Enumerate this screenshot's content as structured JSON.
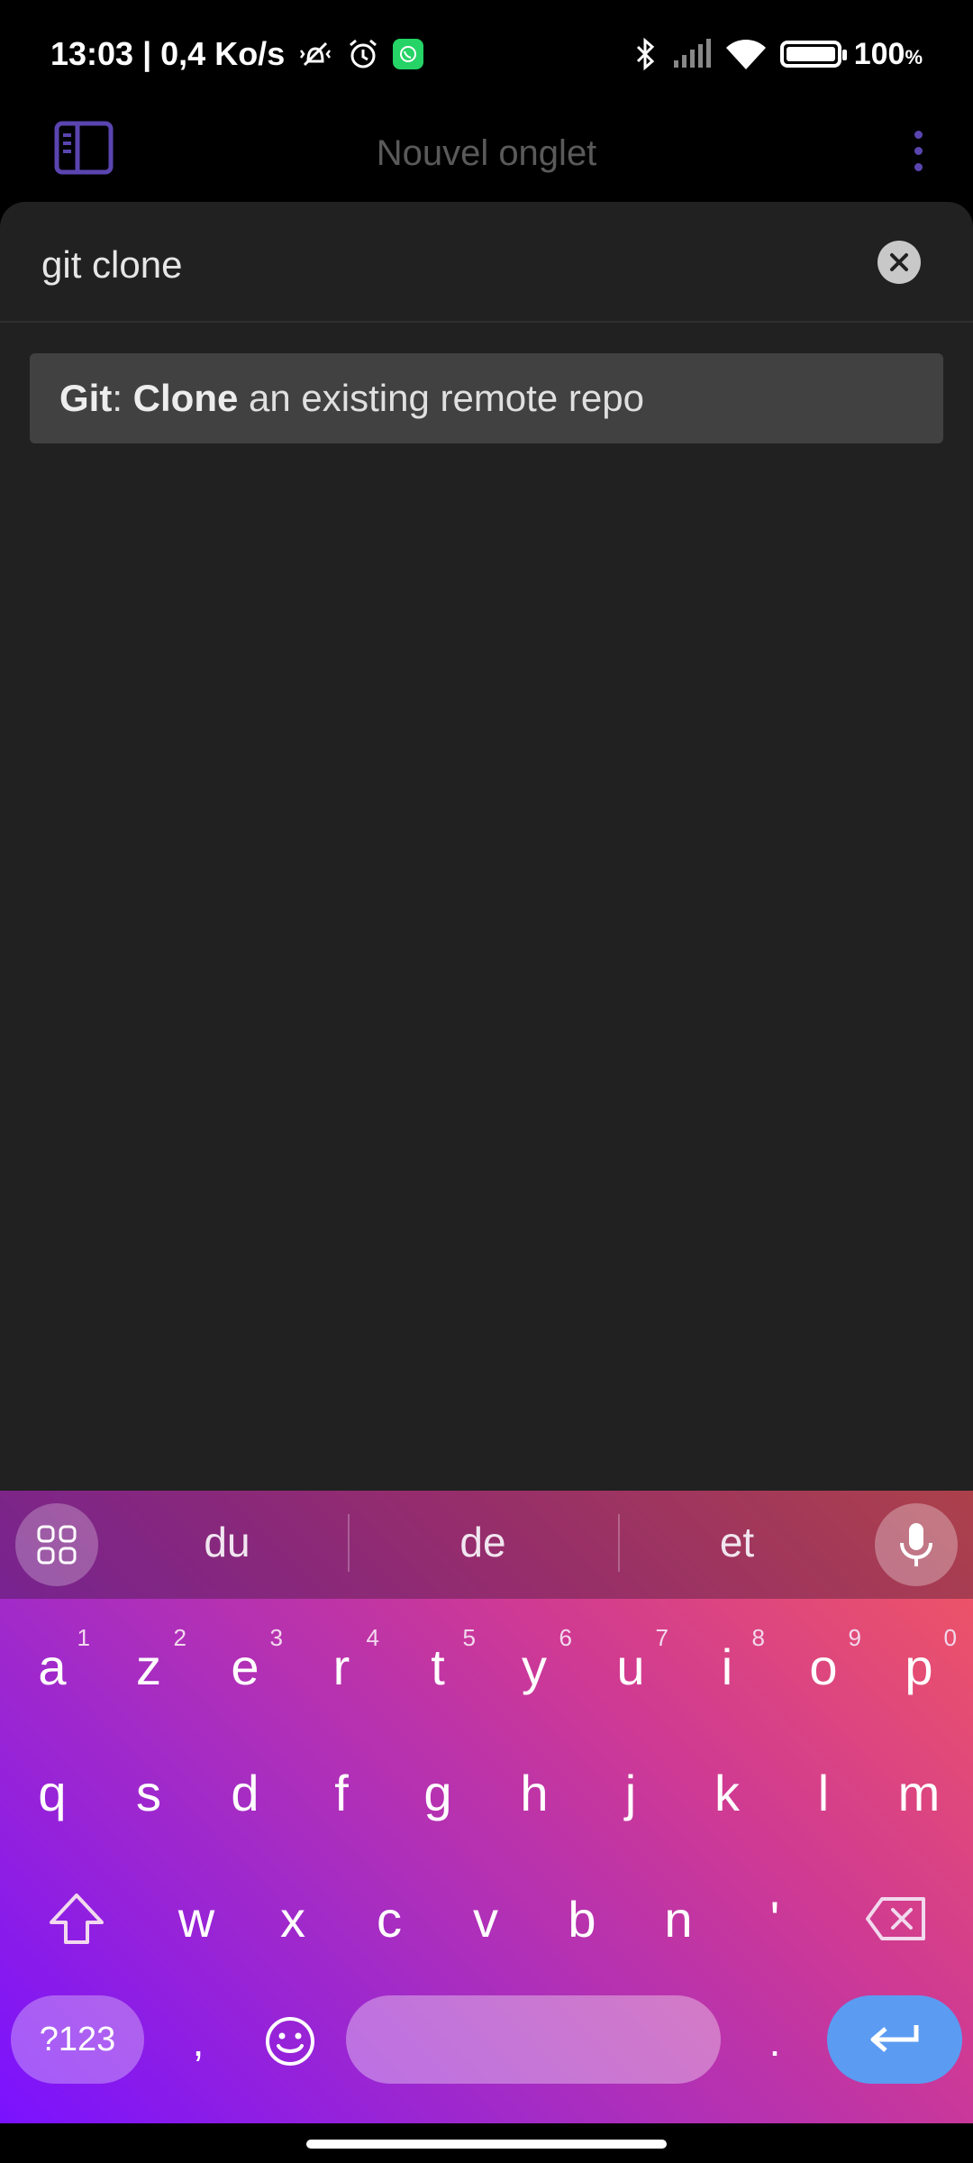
{
  "status_bar": {
    "time_speed": "13:03 | 0,4 Ko/s",
    "battery": "100",
    "battery_unit": "%"
  },
  "app_bar": {
    "title": "Nouvel onglet"
  },
  "search": {
    "value": "git clone"
  },
  "results": [
    {
      "prefix_bold": "Git",
      "separator": ": ",
      "keyword_bold": "Clone",
      "rest": " an existing remote repo"
    }
  ],
  "keyboard": {
    "suggestions": [
      "du",
      "de",
      "et"
    ],
    "row1": [
      {
        "key": "a",
        "hint": "1"
      },
      {
        "key": "z",
        "hint": "2"
      },
      {
        "key": "e",
        "hint": "3"
      },
      {
        "key": "r",
        "hint": "4"
      },
      {
        "key": "t",
        "hint": "5"
      },
      {
        "key": "y",
        "hint": "6"
      },
      {
        "key": "u",
        "hint": "7"
      },
      {
        "key": "i",
        "hint": "8"
      },
      {
        "key": "o",
        "hint": "9"
      },
      {
        "key": "p",
        "hint": "0"
      }
    ],
    "row2": [
      "q",
      "s",
      "d",
      "f",
      "g",
      "h",
      "j",
      "k",
      "l",
      "m"
    ],
    "row3": [
      "w",
      "x",
      "c",
      "v",
      "b",
      "n",
      "'"
    ],
    "numeric_label": "?123",
    "comma": ",",
    "period": "."
  },
  "colors": {
    "accent": "#5a45b0",
    "panel_bg": "#212121",
    "result_bg": "#414141",
    "enter_key": "#5b9bf2"
  },
  "icons": {
    "sidebar": "sidebar-toggle-icon",
    "menu": "more-vert-icon",
    "clear": "close-icon",
    "mic": "microphone-icon",
    "grid": "apps-grid-icon",
    "shift": "shift-arrow-icon",
    "backspace": "backspace-icon",
    "emoji": "emoji-icon",
    "enter": "enter-arrow-icon"
  }
}
